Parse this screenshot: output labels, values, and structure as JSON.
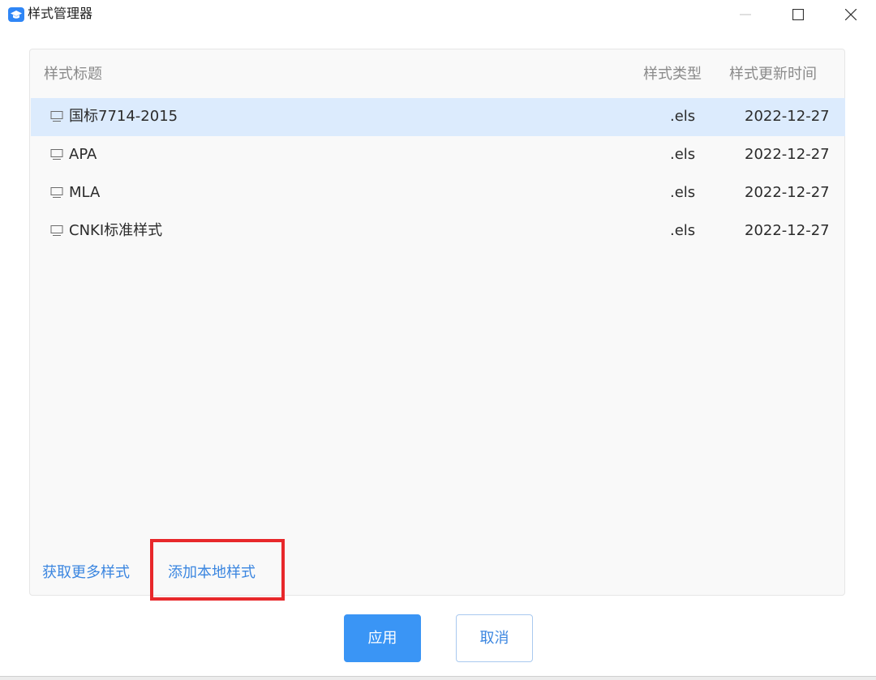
{
  "window": {
    "title": "样式管理器",
    "app_icon": "graduation-cap-icon",
    "controls": [
      "minimize-icon",
      "maximize-icon",
      "close-icon"
    ]
  },
  "table": {
    "headers": {
      "title": "样式标题",
      "type": "样式类型",
      "updated": "样式更新时间"
    },
    "rows": [
      {
        "name": "国标7714-2015",
        "type": ".els",
        "date": "2022-12-27",
        "icon": "monitor-icon",
        "selected": true
      },
      {
        "name": "APA",
        "type": ".els",
        "date": "2022-12-27",
        "icon": "monitor-icon",
        "selected": false
      },
      {
        "name": "MLA",
        "type": ".els",
        "date": "2022-12-27",
        "icon": "monitor-icon",
        "selected": false
      },
      {
        "name": "CNKI标准样式",
        "type": ".els",
        "date": "2022-12-27",
        "icon": "monitor-icon",
        "selected": false
      }
    ]
  },
  "links": {
    "get_more": "获取更多样式",
    "add_local": "添加本地样式"
  },
  "buttons": {
    "apply": "应用",
    "cancel": "取消"
  },
  "colors": {
    "accent": "#3a95f5",
    "link": "#3b86e0",
    "selected_row": "#dcebfd",
    "highlight": "#e8282b"
  }
}
